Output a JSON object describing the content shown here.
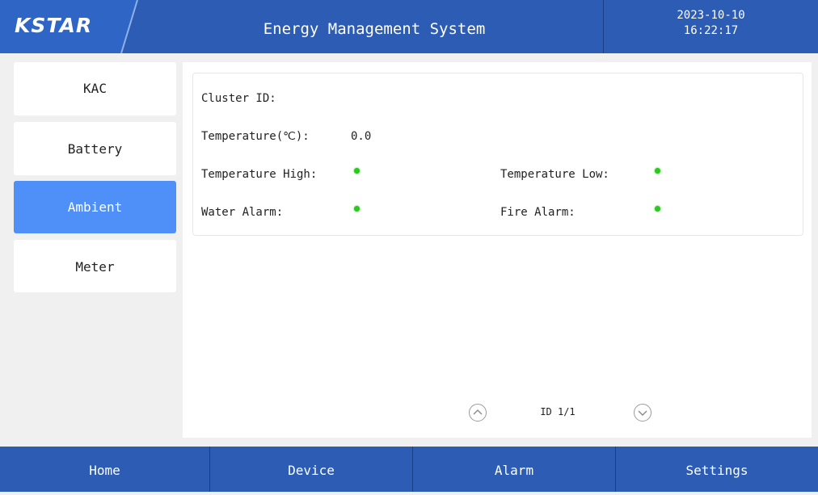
{
  "header": {
    "logo": "KSTAR",
    "title": "Energy Management System",
    "date": "2023-10-10",
    "time": "16:22:17"
  },
  "sidebar": {
    "items": [
      {
        "label": "KAC",
        "active": false
      },
      {
        "label": "Battery",
        "active": false
      },
      {
        "label": "Ambient",
        "active": true
      },
      {
        "label": "Meter",
        "active": false
      }
    ]
  },
  "ambient": {
    "cluster_id_label": "Cluster ID:",
    "cluster_id_value": "",
    "temperature_label": "Temperature(℃):",
    "temperature_value": "0.0",
    "temp_high_label": "Temperature High:",
    "temp_high_status": "normal",
    "temp_low_label": "Temperature Low:",
    "temp_low_status": "normal",
    "water_alarm_label": "Water Alarm:",
    "water_alarm_status": "normal",
    "fire_alarm_label": "Fire Alarm:",
    "fire_alarm_status": "normal",
    "status_color": "#2cc71f"
  },
  "pager": {
    "text": "ID 1/1"
  },
  "footer": {
    "items": [
      "Home",
      "Device",
      "Alarm",
      "Settings"
    ]
  },
  "colors": {
    "header_bg": "#2d5cb4",
    "active_tab": "#4e90f7"
  }
}
